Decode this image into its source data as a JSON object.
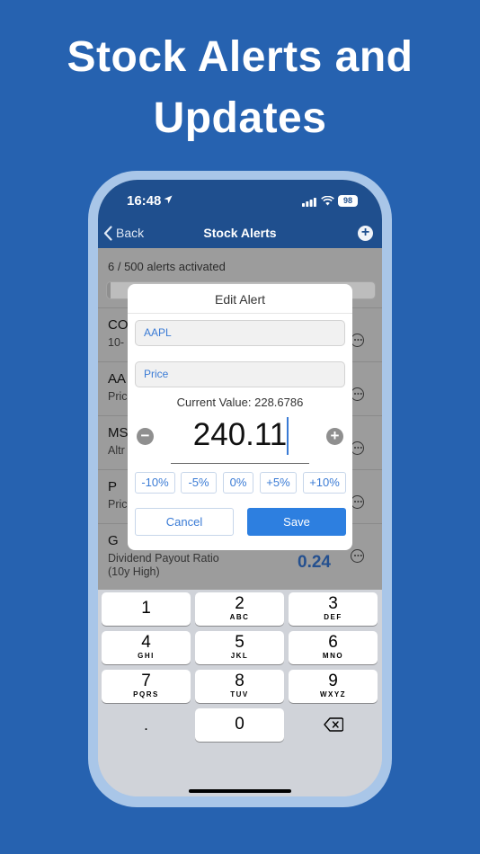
{
  "headline": {
    "line1": "Stock Alerts and",
    "line2": "Updates"
  },
  "status_bar": {
    "time": "16:48",
    "battery": "98"
  },
  "navbar": {
    "back_label": "Back",
    "title": "Stock Alerts"
  },
  "summary": {
    "alerts_text": "6 / 500 alerts activated",
    "progress_fraction": 0.012
  },
  "alerts": [
    {
      "symbol": "CO",
      "subtitle": "10-"
    },
    {
      "symbol": "AA",
      "subtitle": "Pric"
    },
    {
      "symbol": "MS",
      "subtitle": "Altr"
    },
    {
      "symbol": "P",
      "subtitle": "Pric"
    },
    {
      "symbol": "G",
      "subtitle": "Dividend Payout Ratio\n(10y High)",
      "value": "0.24"
    }
  ],
  "dialog": {
    "title": "Edit Alert",
    "symbol_field": "AAPL",
    "metric_field": "Price",
    "current_value_label": "Current Value: 228.6786",
    "price_value": "240.11",
    "minus_label": "−",
    "plus_label": "+",
    "percent_buttons": [
      "-10%",
      "-5%",
      "0%",
      "+5%",
      "+10%"
    ],
    "cancel_label": "Cancel",
    "save_label": "Save"
  },
  "keypad": {
    "keys": [
      {
        "num": "1",
        "letters": ""
      },
      {
        "num": "2",
        "letters": "ABC"
      },
      {
        "num": "3",
        "letters": "DEF"
      },
      {
        "num": "4",
        "letters": "GHI"
      },
      {
        "num": "5",
        "letters": "JKL"
      },
      {
        "num": "6",
        "letters": "MNO"
      },
      {
        "num": "7",
        "letters": "PQRS"
      },
      {
        "num": "8",
        "letters": "TUV"
      },
      {
        "num": "9",
        "letters": "WXYZ"
      },
      {
        "num": ".",
        "letters": ""
      },
      {
        "num": "0",
        "letters": ""
      }
    ]
  },
  "colors": {
    "background": "#2662b0",
    "navbar": "#1f4f8e",
    "accent": "#2d7fe0",
    "value_text": "#24508f"
  }
}
